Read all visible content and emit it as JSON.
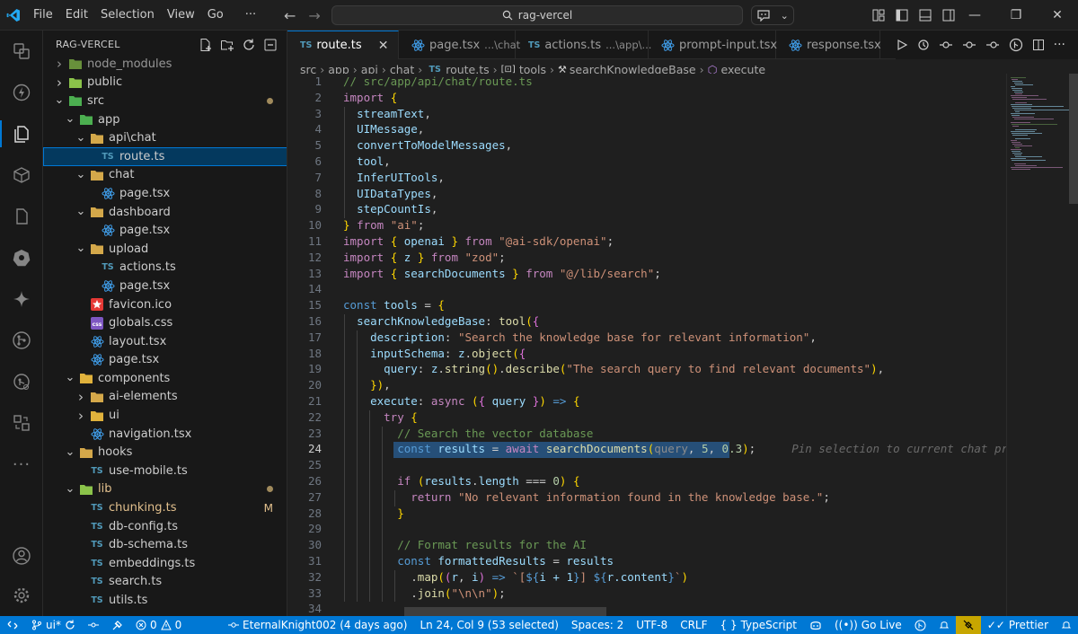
{
  "menu": [
    "File",
    "Edit",
    "Selection",
    "View",
    "Go",
    "···"
  ],
  "command_center": {
    "text": "rag-vercel"
  },
  "sidebar": {
    "title": "RAG-VERCEL",
    "tree": [
      {
        "label": "node_modules",
        "depth": 1,
        "kind": "folder",
        "open": false,
        "icon_color": "#8bc34a"
      },
      {
        "label": "public",
        "depth": 1,
        "kind": "folder",
        "open": false,
        "icon_color": "#8bc34a"
      },
      {
        "label": "src",
        "depth": 1,
        "kind": "folder",
        "open": true,
        "icon_color": "#4caf50",
        "dot": true
      },
      {
        "label": "app",
        "depth": 2,
        "kind": "folder",
        "open": true,
        "icon_color": "#4caf50"
      },
      {
        "label": "api\\chat",
        "depth": 3,
        "kind": "folder",
        "open": true,
        "icon_color": "#d4a84a"
      },
      {
        "label": "route.ts",
        "depth": 4,
        "kind": "ts",
        "selected": true
      },
      {
        "label": "chat",
        "depth": 3,
        "kind": "folder",
        "open": true,
        "icon_color": "#d4a84a"
      },
      {
        "label": "page.tsx",
        "depth": 4,
        "kind": "tsx"
      },
      {
        "label": "dashboard",
        "depth": 3,
        "kind": "folder",
        "open": true,
        "icon_color": "#d4a84a"
      },
      {
        "label": "page.tsx",
        "depth": 4,
        "kind": "tsx"
      },
      {
        "label": "upload",
        "depth": 3,
        "kind": "folder",
        "open": true,
        "icon_color": "#d4a84a"
      },
      {
        "label": "actions.ts",
        "depth": 4,
        "kind": "ts"
      },
      {
        "label": "page.tsx",
        "depth": 4,
        "kind": "tsx"
      },
      {
        "label": "favicon.ico",
        "depth": 3,
        "kind": "ico"
      },
      {
        "label": "globals.css",
        "depth": 3,
        "kind": "css"
      },
      {
        "label": "layout.tsx",
        "depth": 3,
        "kind": "tsx"
      },
      {
        "label": "page.tsx",
        "depth": 3,
        "kind": "tsx"
      },
      {
        "label": "components",
        "depth": 2,
        "kind": "folder",
        "open": true,
        "icon_color": "#e0b23c"
      },
      {
        "label": "ai-elements",
        "depth": 3,
        "kind": "folder",
        "open": false,
        "icon_color": "#d4a84a"
      },
      {
        "label": "ui",
        "depth": 3,
        "kind": "folder",
        "open": false,
        "icon_color": "#e0b23c"
      },
      {
        "label": "navigation.tsx",
        "depth": 3,
        "kind": "tsx"
      },
      {
        "label": "hooks",
        "depth": 2,
        "kind": "folder",
        "open": true,
        "icon_color": "#d4a84a"
      },
      {
        "label": "use-mobile.ts",
        "depth": 3,
        "kind": "ts"
      },
      {
        "label": "lib",
        "depth": 2,
        "kind": "folder",
        "open": true,
        "icon_color": "#8bc34a",
        "dot": true,
        "modified": true
      },
      {
        "label": "chunking.ts",
        "depth": 3,
        "kind": "ts",
        "badge": "M",
        "modified": true
      },
      {
        "label": "db-config.ts",
        "depth": 3,
        "kind": "ts"
      },
      {
        "label": "db-schema.ts",
        "depth": 3,
        "kind": "ts"
      },
      {
        "label": "embeddings.ts",
        "depth": 3,
        "kind": "ts"
      },
      {
        "label": "search.ts",
        "depth": 3,
        "kind": "ts"
      },
      {
        "label": "utils.ts",
        "depth": 3,
        "kind": "ts"
      }
    ]
  },
  "tabs": [
    {
      "label": "route.ts",
      "desc": "",
      "kind": "ts",
      "active": true
    },
    {
      "label": "page.tsx",
      "desc": "...\\chat",
      "kind": "tsx"
    },
    {
      "label": "actions.ts",
      "desc": "...\\app\\...",
      "kind": "ts"
    },
    {
      "label": "prompt-input.tsx",
      "desc": "",
      "kind": "tsx"
    },
    {
      "label": "response.tsx",
      "desc": "",
      "kind": "tsx"
    }
  ],
  "breadcrumb": [
    "src",
    "app",
    "api",
    "chat",
    "route.ts",
    "tools",
    "searchKnowledgeBase",
    "execute"
  ],
  "editor": {
    "current_line": 24,
    "inline_hint": "Pin selection to current chat promp",
    "lines": [
      {
        "n": 1,
        "code": "// src/app/api/chat/route.ts"
      },
      {
        "n": 2,
        "code": "import {"
      },
      {
        "n": 3,
        "code": "  streamText,"
      },
      {
        "n": 4,
        "code": "  UIMessage,"
      },
      {
        "n": 5,
        "code": "  convertToModelMessages,"
      },
      {
        "n": 6,
        "code": "  tool,"
      },
      {
        "n": 7,
        "code": "  InferUITools,"
      },
      {
        "n": 8,
        "code": "  UIDataTypes,"
      },
      {
        "n": 9,
        "code": "  stepCountIs,"
      },
      {
        "n": 10,
        "code": "} from \"ai\";"
      },
      {
        "n": 11,
        "code": "import { openai } from \"@ai-sdk/openai\";"
      },
      {
        "n": 12,
        "code": "import { z } from \"zod\";"
      },
      {
        "n": 13,
        "code": "import { searchDocuments } from \"@/lib/search\";"
      },
      {
        "n": 14,
        "code": ""
      },
      {
        "n": 15,
        "code": "const tools = {"
      },
      {
        "n": 16,
        "code": "  searchKnowledgeBase: tool({"
      },
      {
        "n": 17,
        "code": "    description: \"Search the knowledge base for relevant information\","
      },
      {
        "n": 18,
        "code": "    inputSchema: z.object({"
      },
      {
        "n": 19,
        "code": "      query: z.string().describe(\"The search query to find relevant documents\"),"
      },
      {
        "n": 20,
        "code": "    }),"
      },
      {
        "n": 21,
        "code": "    execute: async ({ query }) => {"
      },
      {
        "n": 22,
        "code": "      try {"
      },
      {
        "n": 23,
        "code": "        // Search the vector database"
      },
      {
        "n": 24,
        "code": "        const results = await searchDocuments(query, 5, 0.3);"
      },
      {
        "n": 25,
        "code": ""
      },
      {
        "n": 26,
        "code": "        if (results.length === 0) {"
      },
      {
        "n": 27,
        "code": "          return \"No relevant information found in the knowledge base.\";"
      },
      {
        "n": 28,
        "code": "        }"
      },
      {
        "n": 29,
        "code": ""
      },
      {
        "n": 30,
        "code": "        // Format results for the AI"
      },
      {
        "n": 31,
        "code": "        const formattedResults = results"
      },
      {
        "n": 32,
        "code": "          .map((r, i) => `[${i + 1}] ${r.content}`)"
      },
      {
        "n": 33,
        "code": "          .join(\"\\n\\n\");"
      },
      {
        "n": 34,
        "code": ""
      }
    ]
  },
  "statusbar": {
    "branch": "ui*",
    "errors": "0",
    "warnings": "0",
    "blame": "EternalKnight002 (4 days ago)",
    "position": "Ln 24, Col 9 (53 selected)",
    "spaces": "Spaces: 2",
    "encoding": "UTF-8",
    "eol": "CRLF",
    "language": "TypeScript",
    "golive": "Go Live",
    "prettier": "Prettier"
  },
  "colors": {
    "accent": "#0078d4",
    "statusbar": "#0078d4",
    "selection": "#264f78",
    "modified": "#e2c08d"
  }
}
